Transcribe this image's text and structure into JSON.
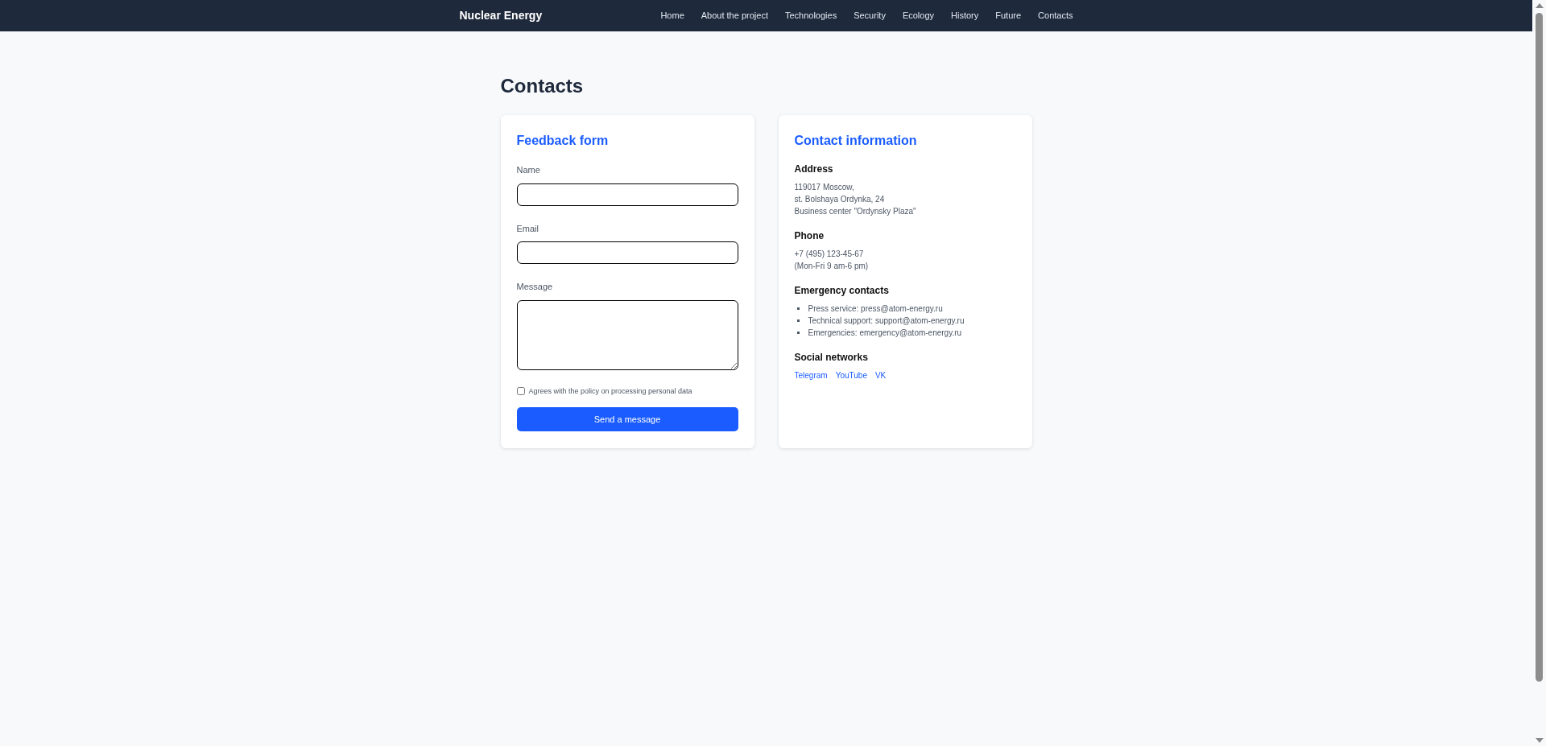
{
  "navbar": {
    "logo": "Nuclear Energy",
    "links": [
      "Home",
      "About the project",
      "Technologies",
      "Security",
      "Ecology",
      "History",
      "Future",
      "Contacts"
    ]
  },
  "page_title": "Contacts",
  "feedback_form": {
    "title": "Feedback form",
    "fields": [
      {
        "label": "Name",
        "kind": "input"
      },
      {
        "label": "Email",
        "kind": "input"
      },
      {
        "label": "Message",
        "kind": "textarea"
      }
    ],
    "consent": {
      "label": "Agrees with the policy on processing personal data",
      "checked": false
    },
    "submit": "Send a message"
  },
  "contact_information": {
    "title": "Contact information",
    "sections": [
      {
        "heading": "Address",
        "kind": "lines",
        "lines": [
          "119017 Moscow,",
          "st. Bolshaya Ordynka, 24",
          "Business center \"Ordynsky Plaza\""
        ]
      },
      {
        "heading": "Phone",
        "kind": "lines",
        "lines": [
          "+7 (495) 123-45-67",
          "(Mon-Fri 9 am-6 pm)"
        ]
      },
      {
        "heading": "Emergency contacts",
        "kind": "list",
        "lines": [
          "Press service: press@atom-energy.ru",
          "Technical support: support@atom-energy.ru",
          "Emergencies: emergency@atom-energy.ru"
        ]
      },
      {
        "heading": "Social networks",
        "kind": "links",
        "lines": [
          "Telegram",
          "YouTube",
          "VK"
        ]
      }
    ]
  }
}
